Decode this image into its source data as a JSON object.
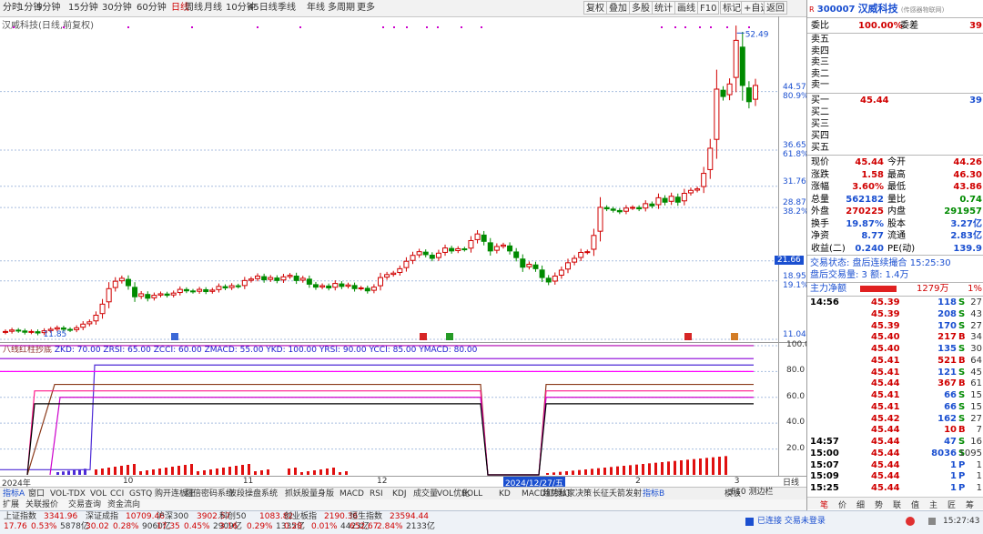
{
  "period_tabs": [
    "分时",
    "1分钟",
    "5分钟",
    "15分钟",
    "30分钟",
    "60分钟",
    "日线",
    "周线",
    "月线",
    "10分钟",
    "45日线",
    "季线",
    "年线",
    "多周期",
    "更多"
  ],
  "active_period": "日线",
  "toolbar_buttons": [
    "复权",
    "叠加",
    "多股",
    "统计",
    "画线",
    "F10",
    "标记",
    "+自选",
    "返回"
  ],
  "chart_title": "汉威科技(日线,前复权)",
  "price_axis": [
    {
      "label": "44.57",
      "pct": "80.9%"
    },
    {
      "label": "36.65",
      "pct": "61.8%"
    },
    {
      "label": "31.76",
      "pct": ""
    },
    {
      "label": "28.87",
      "pct": "38.2%"
    },
    {
      "label": "21.66",
      "pct": ""
    },
    {
      "label": "18.95",
      "pct": "19.1%"
    },
    {
      "label": "11.04",
      "pct": ""
    }
  ],
  "high_label": "52.49",
  "low_label": "11.85",
  "indicator_title": "八线红柱抄底",
  "indicator_params": "ZKD: 70.00  ZRSI: 65.00  ZCCI: 60.00  ZMACD: 55.00  YKD: 100.00  YRSI: 90.00  YCCI: 85.00  YMACD: 80.00",
  "indicator_axis": [
    "100.0",
    "80.0",
    "60.0",
    "40.0",
    "20.0"
  ],
  "date_axis": [
    {
      "label": "2024年",
      "date": "2024-09-01"
    },
    {
      "label": "10",
      "date": "2024-10-01"
    },
    {
      "label": "11",
      "date": "2024-11-01"
    },
    {
      "label": "12",
      "date": "2024-12-01"
    },
    {
      "label": "2024/12/27/五",
      "date": "2024-12-27"
    },
    {
      "label": "2",
      "date": "2025-02-01"
    },
    {
      "label": "3",
      "date": "2025-03-01"
    }
  ],
  "tabs_row1": [
    "指标A",
    "窗口",
    "VOL-TDX",
    "VOL",
    "CCI",
    "GSTQ",
    "购开连板王",
    "翻倍密码系统",
    "波段操盘系统",
    "抓妖股量身版",
    "MACD",
    "RSI",
    "KDJ",
    "成交量",
    "VOL优化",
    "BOLL",
    "KD",
    "MACD红绿灯",
    "趋势私家决策",
    "长征夭箭发射",
    "指标B",
    "模板"
  ],
  "tabs_row2": [
    "扩展",
    "关联报价",
    "交易查询",
    "资金流向"
  ],
  "stock": {
    "code": "300007",
    "name": "汉威科技",
    "sub": "(传感器物联网)"
  },
  "weibi": {
    "label": "委比",
    "value": "100.00%",
    "diff_label": "委差",
    "diff": "39"
  },
  "asks": [
    "卖五",
    "卖四",
    "卖三",
    "卖二",
    "卖一"
  ],
  "bids": [
    {
      "label": "买一",
      "price": "45.44",
      "vol": "39"
    },
    {
      "label": "买二",
      "price": "",
      "vol": ""
    },
    {
      "label": "买三",
      "price": "",
      "vol": ""
    },
    {
      "label": "买四",
      "price": "",
      "vol": ""
    },
    {
      "label": "买五",
      "price": "",
      "vol": ""
    }
  ],
  "quote": [
    {
      "l1": "现价",
      "v1": "45.44",
      "c1": "red",
      "l2": "今开",
      "v2": "44.26",
      "c2": "red"
    },
    {
      "l1": "涨跌",
      "v1": "1.58",
      "c1": "red",
      "l2": "最高",
      "v2": "46.30",
      "c2": "red"
    },
    {
      "l1": "涨幅",
      "v1": "3.60%",
      "c1": "red",
      "l2": "最低",
      "v2": "43.86",
      "c2": "red"
    },
    {
      "l1": "总量",
      "v1": "562182",
      "c1": "blue",
      "l2": "量比",
      "v2": "0.74",
      "c2": "green"
    },
    {
      "l1": "外盘",
      "v1": "270225",
      "c1": "red",
      "l2": "内盘",
      "v2": "291957",
      "c2": "green"
    },
    {
      "l1": "换手",
      "v1": "19.87%",
      "c1": "blue",
      "l2": "股本",
      "v2": "3.27亿",
      "c2": "blue"
    },
    {
      "l1": "净资",
      "v1": "8.77",
      "c1": "blue",
      "l2": "流通",
      "v2": "2.83亿",
      "c2": "blue"
    },
    {
      "l1": "收益(二)",
      "v1": "0.240",
      "c1": "blue",
      "l2": "PE(动)",
      "v2": "139.9",
      "c2": "blue"
    }
  ],
  "trade_status": "交易状态: 盘后连续撮合  15:25:30",
  "after_hours": "盘后交易量: 3  额: 1.4万",
  "main_flow": {
    "label": "主力净额",
    "value": "1279万",
    "pct": "1%"
  },
  "ticks": [
    {
      "t": "14:56",
      "p": "45.39",
      "v": "118",
      "s": "S",
      "n": "27"
    },
    {
      "t": "",
      "p": "45.39",
      "v": "208",
      "s": "S",
      "n": "43"
    },
    {
      "t": "",
      "p": "45.39",
      "v": "170",
      "s": "S",
      "n": "27"
    },
    {
      "t": "",
      "p": "45.40",
      "v": "217",
      "s": "B",
      "n": "34"
    },
    {
      "t": "",
      "p": "45.40",
      "v": "135",
      "s": "S",
      "n": "30"
    },
    {
      "t": "",
      "p": "45.41",
      "v": "521",
      "s": "B",
      "n": "64"
    },
    {
      "t": "",
      "p": "45.41",
      "v": "121",
      "s": "S",
      "n": "45"
    },
    {
      "t": "",
      "p": "45.44",
      "v": "367",
      "s": "B",
      "n": "61"
    },
    {
      "t": "",
      "p": "45.41",
      "v": "66",
      "s": "S",
      "n": "15"
    },
    {
      "t": "",
      "p": "45.41",
      "v": "66",
      "s": "S",
      "n": "15"
    },
    {
      "t": "",
      "p": "45.42",
      "v": "162",
      "s": "S",
      "n": "27"
    },
    {
      "t": "",
      "p": "45.44",
      "v": "10",
      "s": "B",
      "n": "7"
    },
    {
      "t": "14:57",
      "p": "45.44",
      "v": "47",
      "s": "S",
      "n": "16"
    },
    {
      "t": "15:00",
      "p": "45.44",
      "v": "8036",
      "s": "S",
      "n": "1095"
    },
    {
      "t": "15:07",
      "p": "45.44",
      "v": "1",
      "s": "P",
      "n": "1"
    },
    {
      "t": "15:09",
      "p": "45.44",
      "v": "1",
      "s": "P",
      "n": "1"
    },
    {
      "t": "15:25",
      "p": "45.44",
      "v": "1",
      "s": "P",
      "n": "1"
    }
  ],
  "right_tabs": [
    "笔",
    "价",
    "细",
    "势",
    "联",
    "值",
    "主",
    "匠",
    "筹"
  ],
  "right_tab_extra": "F10 测边栏",
  "indices": [
    {
      "name": "上证指数",
      "val": "3341.96",
      "chg": "17.76",
      "pct": "0.53%",
      "amt": "5878亿"
    },
    {
      "name": "深证成指",
      "val": "10709.46",
      "chg": "30.02",
      "pct": "0.28%",
      "amt": "9060亿"
    },
    {
      "name": "沪深300",
      "val": "3902.57",
      "chg": "17.35",
      "pct": "0.45%",
      "amt": "2909亿"
    },
    {
      "name": "科创50",
      "val": "1083.82",
      "chg": "3.16",
      "pct": "0.29%",
      "amt": "1335亿"
    },
    {
      "name": "创业板指",
      "val": "2190.36",
      "chg": "0.28",
      "pct": "0.01%",
      "amt": "4423亿"
    },
    {
      "name": "恒生指数",
      "val": "23594.44",
      "chg": "652.67",
      "pct": "2.84%",
      "amt": "2133亿"
    }
  ],
  "status_text": "已连接 交易未登录",
  "clock": "15:27:43",
  "colors": {
    "up": "#d00000",
    "down": "#008a00",
    "axis_blue": "#1a4fd0",
    "grid": "#9db4d8"
  },
  "chart_data": {
    "type": "candlestick",
    "title": "汉威科技(日线,前复权)",
    "ylim": [
      11.04,
      54.5
    ],
    "dates": [
      "2024-09-02",
      "2024-09-03",
      "2024-09-04",
      "2024-09-05",
      "2024-09-06",
      "2024-09-09",
      "2024-09-10",
      "2024-09-11",
      "2024-09-12",
      "2024-09-13",
      "2024-09-18",
      "2024-09-19",
      "2024-09-20",
      "2024-09-23",
      "2024-09-24",
      "2024-09-25",
      "2024-09-26",
      "2024-09-27",
      "2024-09-30",
      "2024-10-08",
      "2024-10-09",
      "2024-10-10",
      "2024-10-11",
      "2024-10-14",
      "2024-10-15",
      "2024-10-16",
      "2024-10-17",
      "2024-10-18",
      "2024-10-21",
      "2024-10-22",
      "2024-10-23",
      "2024-10-24",
      "2024-10-25",
      "2024-10-28",
      "2024-10-29",
      "2024-10-30",
      "2024-10-31",
      "2024-11-01",
      "2024-11-04",
      "2024-11-05",
      "2024-11-06",
      "2024-11-07",
      "2024-11-08",
      "2024-11-11",
      "2024-11-12",
      "2024-11-13",
      "2024-11-14",
      "2024-11-15",
      "2024-11-18",
      "2024-11-19",
      "2024-11-20",
      "2024-11-21",
      "2024-11-22",
      "2024-11-25",
      "2024-11-26",
      "2024-11-27",
      "2024-11-28",
      "2024-11-29",
      "2024-12-02",
      "2024-12-03",
      "2024-12-04",
      "2024-12-05",
      "2024-12-06",
      "2024-12-09",
      "2024-12-10",
      "2024-12-11",
      "2024-12-12",
      "2024-12-13",
      "2024-12-16",
      "2024-12-17",
      "2024-12-18",
      "2024-12-19",
      "2024-12-20",
      "2024-12-23",
      "2024-12-24",
      "2024-12-25",
      "2024-12-26",
      "2024-12-27",
      "2024-12-30",
      "2024-12-31",
      "2025-01-02",
      "2025-01-03",
      "2025-01-06",
      "2025-01-07",
      "2025-01-08",
      "2025-01-09",
      "2025-01-10",
      "2025-01-13",
      "2025-01-14",
      "2025-01-15",
      "2025-01-16",
      "2025-01-17",
      "2025-01-20",
      "2025-01-21",
      "2025-01-22",
      "2025-01-23",
      "2025-01-24",
      "2025-01-27",
      "2025-02-05",
      "2025-02-06",
      "2025-02-07",
      "2025-02-10",
      "2025-02-11",
      "2025-02-12",
      "2025-02-13",
      "2025-02-14",
      "2025-02-17",
      "2025-02-18",
      "2025-02-19",
      "2025-02-20",
      "2025-02-21",
      "2025-02-24",
      "2025-02-25",
      "2025-02-26",
      "2025-02-27",
      "2025-02-28",
      "2025-03-03"
    ],
    "close": [
      12.1,
      12.3,
      12.2,
      12.0,
      12.1,
      11.9,
      12.2,
      12.4,
      12.6,
      12.4,
      12.3,
      12.6,
      13.1,
      13.4,
      14.3,
      15.8,
      17.9,
      18.9,
      19.3,
      18.3,
      16.8,
      17.2,
      16.6,
      17.0,
      17.2,
      17.0,
      17.3,
      17.8,
      17.6,
      17.5,
      17.8,
      17.5,
      17.7,
      18.2,
      18.0,
      18.3,
      18.2,
      19.0,
      19.2,
      19.6,
      19.1,
      19.4,
      19.0,
      19.5,
      19.7,
      19.0,
      19.3,
      18.5,
      18.1,
      18.3,
      18.0,
      18.6,
      18.2,
      18.4,
      17.9,
      18.0,
      17.6,
      18.1,
      19.4,
      19.8,
      20.0,
      20.6,
      21.6,
      22.4,
      22.9,
      22.5,
      22.0,
      22.7,
      23.4,
      23.0,
      23.3,
      23.2,
      24.4,
      25.3,
      24.3,
      23.0,
      23.6,
      23.8,
      23.0,
      22.1,
      20.8,
      21.2,
      20.6,
      19.4,
      18.8,
      19.6,
      20.4,
      21.4,
      22.0,
      22.8,
      22.9,
      25.1,
      28.9,
      28.7,
      28.5,
      28.3,
      28.8,
      28.9,
      28.7,
      29.4,
      29.1,
      30.2,
      29.6,
      30.4,
      29.6,
      30.8,
      31.2,
      31.4,
      33.5,
      36.9,
      44.9,
      43.9,
      45.6,
      51.5,
      45.4,
      43.2,
      45.4
    ]
  },
  "indicator_data": {
    "lines": [
      {
        "name": "YKD",
        "value": 100.0,
        "color": "#b000b0"
      },
      {
        "name": "YRSI",
        "value": 90.0,
        "color": "#8c00d8"
      },
      {
        "name": "YCCI",
        "value": 85.0,
        "color": "#4d2bd6"
      },
      {
        "name": "YMACD",
        "value": 80.0,
        "color": "#ff00ff"
      },
      {
        "name": "ZKD",
        "value": 70.0,
        "color": "#8b3a1a"
      },
      {
        "name": "ZRSI",
        "value": 65.0,
        "color": "#ff1a8c"
      },
      {
        "name": "ZCCI",
        "value": 60.0,
        "color": "#cc00cc"
      },
      {
        "name": "ZMACD",
        "value": 55.0,
        "color": "#000000"
      }
    ]
  }
}
